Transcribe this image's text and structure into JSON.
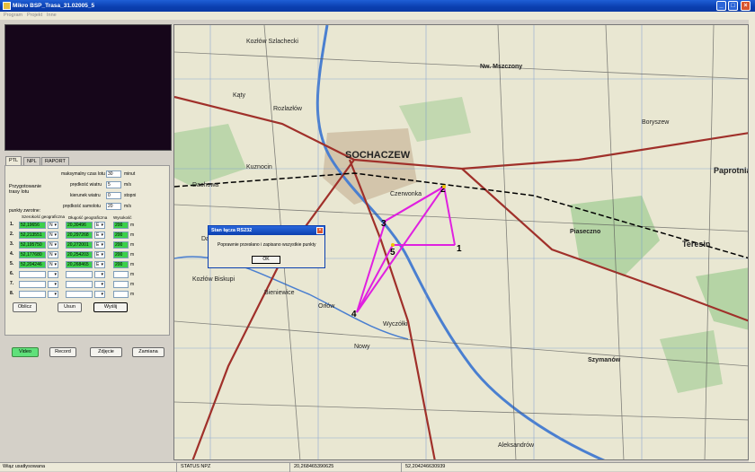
{
  "window": {
    "title": "Mikro BSP_Trasa_31.02005_5",
    "minimize": "_",
    "maximize": "□",
    "close": "×"
  },
  "menu": [
    "Program",
    "Projekt",
    "Inne"
  ],
  "tabs": [
    "PTL",
    "NPL",
    "RAPORT"
  ],
  "form": {
    "section_label": "Przygotowanie trasy lotu",
    "max_time_label": "maksymalny czas lotu",
    "max_time_value": "30",
    "max_time_unit": "minut",
    "wind_speed_label": "prędkość wiatru",
    "wind_speed_value": "5",
    "wind_speed_unit": "m/s",
    "wind_dir_label": "kierunek wiatru",
    "wind_dir_value": "0",
    "wind_dir_unit": "stopni",
    "plane_speed_label": "prędkość samolotu",
    "plane_speed_value": "20",
    "plane_speed_unit": "m/s",
    "points_label": "punkty zwrotne:",
    "col_lat": "Szerokość geograficzna",
    "col_lon": "Długość geograficzna",
    "col_alt": "Wysokość",
    "alt_unit": "m",
    "rows": [
      {
        "n": "1.",
        "lat": "52,19656",
        "ns": "N",
        "lon": "20,30496",
        "ew": "E",
        "alt": "200"
      },
      {
        "n": "2.",
        "lat": "52,213551",
        "ns": "N",
        "lon": "20,297268",
        "ew": "E",
        "alt": "200"
      },
      {
        "n": "3.",
        "lat": "52,195750",
        "ns": "N",
        "lon": "20,272001",
        "ew": "E",
        "alt": "200"
      },
      {
        "n": "4.",
        "lat": "52,177680",
        "ns": "N",
        "lon": "20,254203",
        "ew": "E",
        "alt": "200"
      },
      {
        "n": "5.",
        "lat": "52,204246",
        "ns": "N",
        "lon": "20,268465",
        "ew": "E",
        "alt": "200"
      },
      {
        "n": "6.",
        "lat": "",
        "ns": "",
        "lon": "",
        "ew": "",
        "alt": ""
      },
      {
        "n": "7.",
        "lat": "",
        "ns": "",
        "lon": "",
        "ew": "",
        "alt": ""
      },
      {
        "n": "8.",
        "lat": "",
        "ns": "",
        "lon": "",
        "ew": "",
        "alt": ""
      }
    ],
    "btn_calc": "Oblicz",
    "btn_delete": "Usun",
    "btn_send": "Wyślij"
  },
  "bottom_buttons": {
    "video": "Video",
    "record": "Record",
    "photo": "Zdjęcie",
    "save": "Zamiana"
  },
  "map": {
    "labels": [
      "SOCHACZEW",
      "Kozłów Szlachecki",
      "Nw. Mszczony",
      "Paprotnia",
      "Teresin",
      "Kąty",
      "Kuznocin",
      "Dachowa",
      "Rozlazłów",
      "Wyczółki",
      "Orłów",
      "Nowy",
      "Piaseczno",
      "Szymanów",
      "Boryszew",
      "Czerwonka",
      "Dachowa",
      "Kozłów Biskupi",
      "Bieniewice",
      "Aleksandrów"
    ],
    "waypoint_labels": [
      "1",
      "2",
      "3",
      "4",
      "5"
    ],
    "route_color": "#e020e0"
  },
  "dialog": {
    "title": "Stan łącza RS232",
    "message": "Poprawnie przesłano i zapisano wszystkie punkty",
    "ok": "OK"
  },
  "status": {
    "left": "Wiąz usatłysowana",
    "mid": "STATUS NPZ",
    "lon": "20,268465390625",
    "lat": "52,204246630939"
  }
}
